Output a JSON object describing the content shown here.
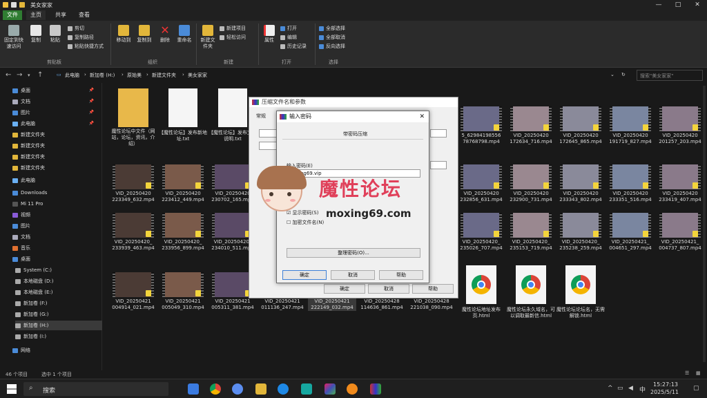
{
  "titlebar": {
    "title": "美女家家"
  },
  "tabs": [
    "文件",
    "主页",
    "共享",
    "查看"
  ],
  "ribbon": {
    "pin_label": "固定到快速访问",
    "copy_label": "复制",
    "paste_label": "粘贴",
    "cut_label": "剪切",
    "copy_path_label": "复制路径",
    "paste_shortcut_label": "粘贴快捷方式",
    "clipboard_group": "剪贴板",
    "move_to_label": "移动到",
    "copy_to_label": "复制到",
    "delete_label": "删除",
    "rename_label": "重命名",
    "organize_group": "组织",
    "new_folder_label": "新建文件夹",
    "new_item_label": "新建项目",
    "easy_access_label": "轻松访问",
    "new_group": "新建",
    "properties_label": "属性",
    "open_label": "打开",
    "edit_label": "编辑",
    "history_label": "历史记录",
    "open_group": "打开",
    "select_all_label": "全部选择",
    "select_none_label": "全部取消",
    "invert_label": "反向选择",
    "select_group": "选择"
  },
  "address": {
    "crumbs": [
      "此电脑",
      "新加卷 (H:)",
      "原始美",
      "新建文件夹",
      "美女家家"
    ],
    "search_placeholder": "搜索\"美女家家\""
  },
  "sidebar": {
    "items": [
      {
        "label": "桌面",
        "pinned": true
      },
      {
        "label": "文档",
        "pinned": true
      },
      {
        "label": "图片",
        "pinned": true
      },
      {
        "label": "此电脑",
        "pinned": true
      },
      {
        "label": "新建文件夹"
      },
      {
        "label": "新建文件夹"
      },
      {
        "label": "新建文件夹"
      },
      {
        "label": "新建文件夹"
      },
      {
        "label": "此电脑"
      },
      {
        "label": "Downloads"
      },
      {
        "label": "Mi 11 Pro"
      },
      {
        "label": "视频"
      },
      {
        "label": "图片"
      },
      {
        "label": "文档"
      },
      {
        "label": "音乐"
      },
      {
        "label": "桌面"
      },
      {
        "label": "System (C:)"
      },
      {
        "label": "本地磁盘 (D:)"
      },
      {
        "label": "本地磁盘 (E:)"
      },
      {
        "label": "新加卷 (F:)"
      },
      {
        "label": "新加卷 (G:)"
      },
      {
        "label": "新加卷 (H:)"
      },
      {
        "label": "新加卷 (I:)"
      },
      {
        "label": "网络"
      }
    ]
  },
  "files": {
    "row1": [
      {
        "name": "魔性论坛中文件（网站，论坛，资讯，介绍）",
        "kind": "folder"
      },
      {
        "name": "【魔性论坛】发布新地址.txt",
        "kind": "doc"
      },
      {
        "name": "【魔性论坛】发布文件说明.txt",
        "kind": "doc"
      },
      {
        "name": "5_62984198556 78768798.mp4",
        "kind": "video"
      },
      {
        "name": "VID_20250420 172634_716.mp4",
        "kind": "video"
      },
      {
        "name": "VID_20250420 172645_865.mp4",
        "kind": "video"
      },
      {
        "name": "VID_20250420 191719_827.mp4",
        "kind": "video"
      },
      {
        "name": "VID_20250420 201257_203.mp4",
        "kind": "video"
      }
    ],
    "row2": [
      {
        "name": "VID_20250420 223349_632.mp4"
      },
      {
        "name": "VID_20250420 223412_449.mp4"
      },
      {
        "name": "VID_20250420 230702_165.mp4"
      },
      {
        "name": "VID_20250420 232856_631.mp4"
      },
      {
        "name": "VID_20250420 232900_731.mp4"
      },
      {
        "name": "VID_20250420 233343_802.mp4"
      },
      {
        "name": "VID_20250420 233351_516.mp4"
      },
      {
        "name": "VID_20250420 233419_407.mp4"
      }
    ],
    "row3": [
      {
        "name": "VID_20250420_ 233939_463.mp4"
      },
      {
        "name": "VID_20250420_ 233956_899.mp4"
      },
      {
        "name": "VID_20250420_ 234010_511.mp4"
      },
      {
        "name": "VID_20250420_ 235026_707.mp4"
      },
      {
        "name": "VID_20250420_ 235153_719.mp4"
      },
      {
        "name": "VID_20250420_ 235238_259.mp4"
      },
      {
        "name": "VID_20250421_ 004651_297.mp4"
      },
      {
        "name": "VID_20250421_ 004737_807.mp4"
      }
    ],
    "row4": [
      {
        "name": "VID_20250421 004914_021.mp4",
        "kind": "video"
      },
      {
        "name": "VID_20250421 005049_310.mp4",
        "kind": "video"
      },
      {
        "name": "VID_20250421 005311_381.mp4",
        "kind": "video"
      },
      {
        "name": "VID_20250421 011136_247.mp4",
        "kind": "video"
      },
      {
        "name": "VID_20250421 222149_032.mp4",
        "kind": "video"
      },
      {
        "name": "VID_20250428 114636_861.mp4",
        "kind": "video"
      },
      {
        "name": "VID_20250428 221038_090.mp4",
        "kind": "video"
      },
      {
        "name": "魔性论坛地址发布页.html",
        "kind": "html"
      },
      {
        "name": "魔性论坛永久域名，可以调取最新信.html",
        "kind": "html"
      },
      {
        "name": "魔性论坛论坛名，无需解锁.html",
        "kind": "html"
      }
    ]
  },
  "dialog_compress": {
    "title": "压缩文件名和参数",
    "tab_general": "常规",
    "ok": "确定",
    "cancel": "取消",
    "help": "帮助"
  },
  "dialog_password": {
    "title": "输入密码",
    "section": "带密码压缩",
    "enter_label": "输入密码(E)",
    "password_value": "moxing69.vip",
    "show_password": "显示密码(S)",
    "encrypt_names": "加密文件名(N)",
    "organize_btn": "整理密码(O)...",
    "ok": "确定",
    "cancel": "取消",
    "help": "帮助"
  },
  "watermark": {
    "title": "魔性论坛",
    "url": "moxing69.com"
  },
  "status": {
    "count": "46 个项目",
    "selected": "选中 1 个项目"
  },
  "taskbar": {
    "search_label": "搜索",
    "time": "15:27:13",
    "date": "2025/5/11",
    "ime": "中"
  }
}
